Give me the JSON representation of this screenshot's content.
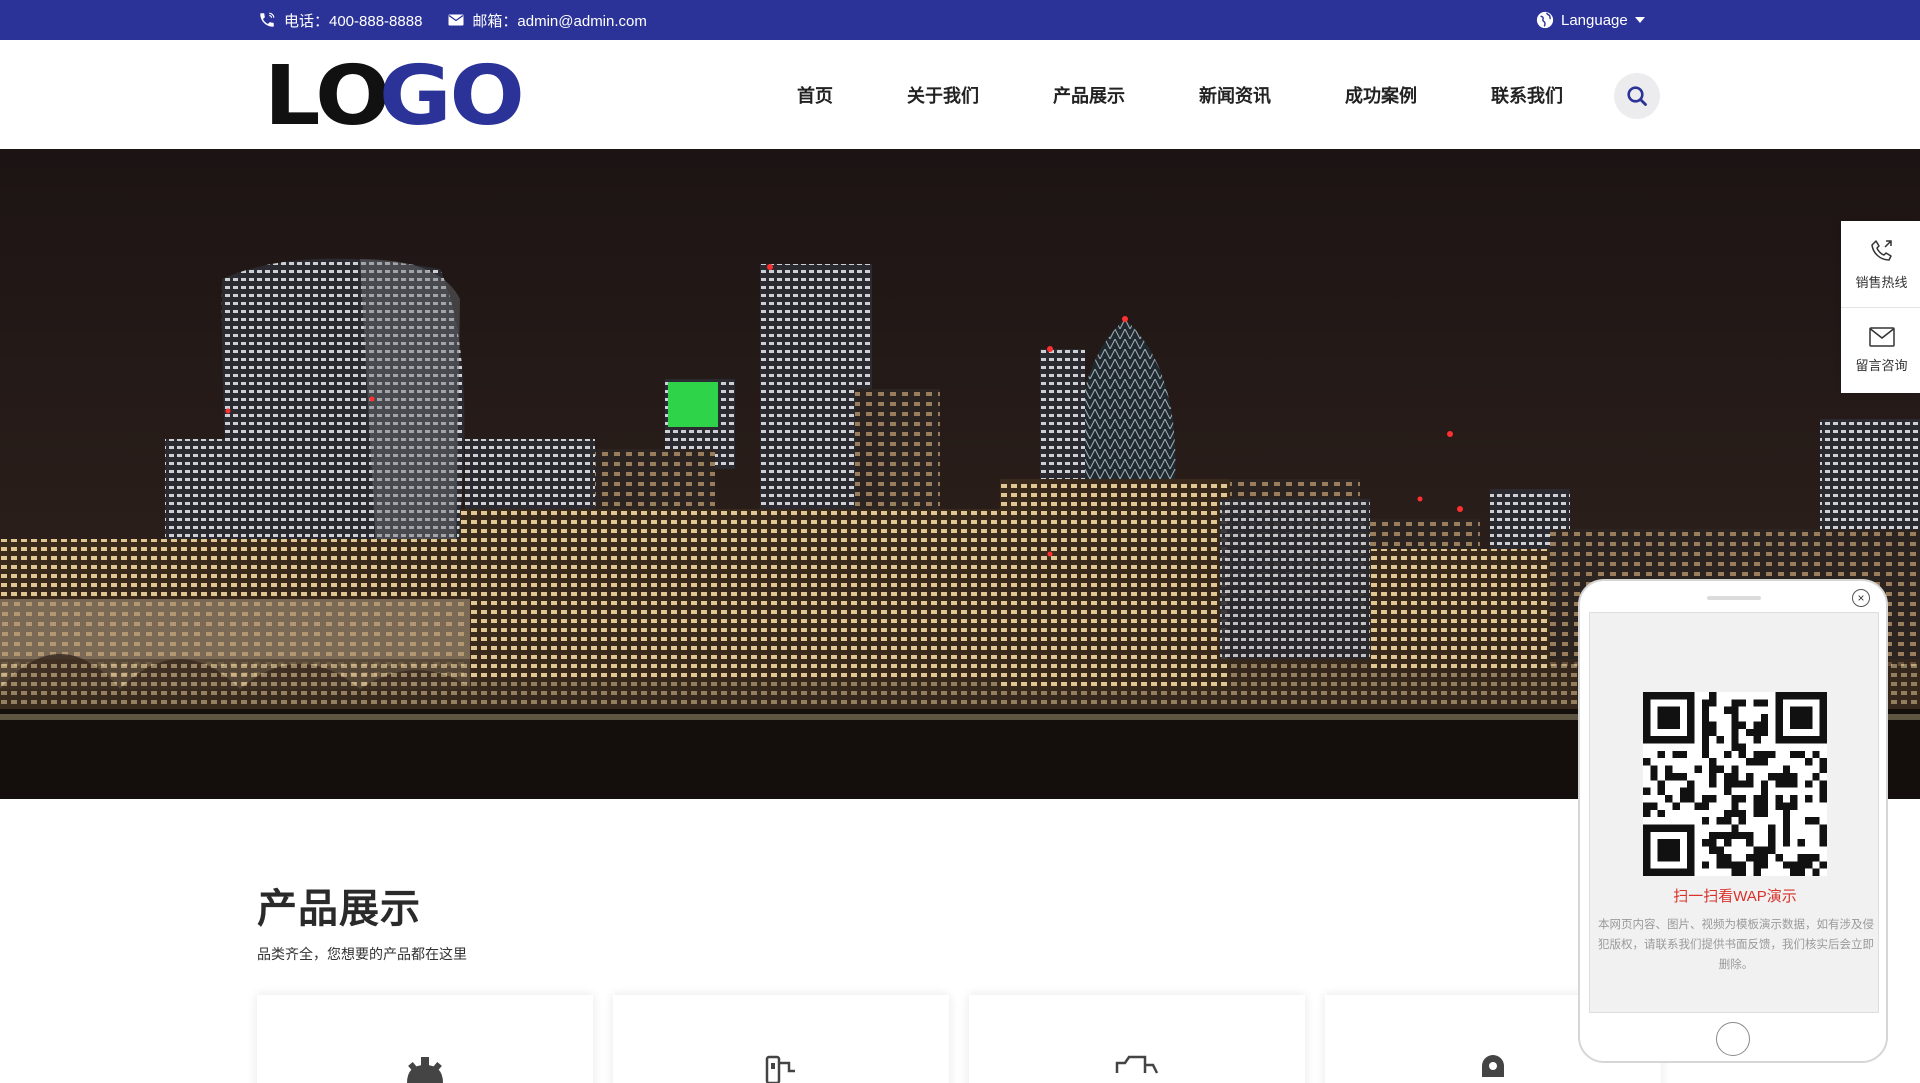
{
  "topbar": {
    "phone": "电话：400-888-8888",
    "email": "邮箱：admin@admin.com",
    "language": "Language"
  },
  "header": {
    "logo_dark": "LO",
    "logo_blue": "GO",
    "nav": [
      "首页",
      "关于我们",
      "产品展示",
      "新闻资讯",
      "成功案例",
      "联系我们"
    ]
  },
  "products": {
    "title": "产品展示",
    "subtitle": "品类齐全，您想要的产品都在这里"
  },
  "floatbar": {
    "hotline": "销售热线",
    "message": "留言咨询"
  },
  "qr_popup": {
    "scan_label": "扫一扫看WAP演示",
    "note": "本网页内容、图片、视频为模板演示数据，如有涉及侵犯版权，请联系我们提供书面反馈，我们核实后会立即删除。",
    "close": "×"
  },
  "colors": {
    "brand": "#2b3399",
    "accent_red": "#d9322b"
  }
}
